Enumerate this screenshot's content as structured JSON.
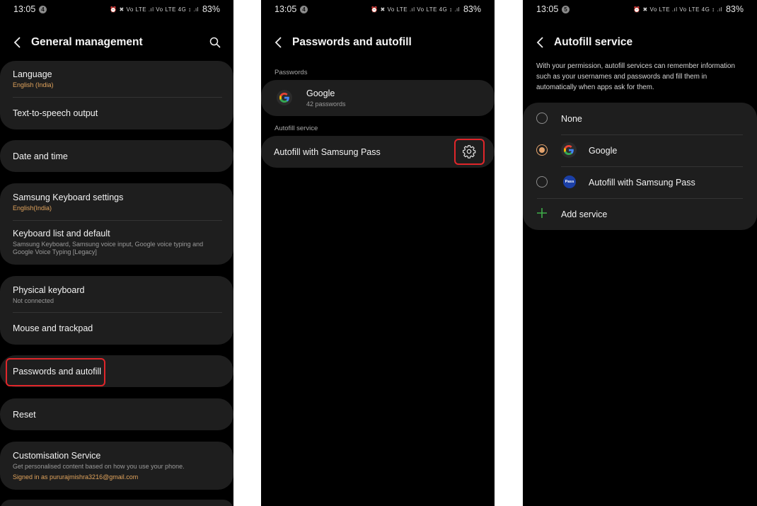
{
  "status": {
    "time": "13:05",
    "battery": "83%",
    "signal_text": "⏰ ✖ Vo LTE .ıl Vo LTE 4G ↕ .ıl"
  },
  "notifications": [
    "4",
    "4",
    "5"
  ],
  "screen1": {
    "title": "General management",
    "items": {
      "language": {
        "label": "Language",
        "sub": "English (India)"
      },
      "tts": {
        "label": "Text-to-speech output"
      },
      "date_time": {
        "label": "Date and time"
      },
      "keyboard_settings": {
        "label": "Samsung Keyboard settings",
        "sub": "English(India)"
      },
      "keyboard_list": {
        "label": "Keyboard list and default",
        "sub": "Samsung Keyboard, Samsung voice input, Google voice typing and Google Voice Typing [Legacy]"
      },
      "physical_keyboard": {
        "label": "Physical keyboard",
        "sub": "Not connected"
      },
      "mouse": {
        "label": "Mouse and trackpad"
      },
      "passwords": {
        "label": "Passwords and autofill"
      },
      "reset": {
        "label": "Reset"
      },
      "customisation": {
        "label": "Customisation Service",
        "sub": "Get personalised content based on how you use your phone.",
        "sub2": "Signed in as pururajmishra3216@gmail.com"
      }
    }
  },
  "screen2": {
    "title": "Passwords and autofill",
    "section_passwords": "Passwords",
    "google": {
      "name": "Google",
      "count": "42 passwords"
    },
    "section_autofill": "Autofill service",
    "autofill": {
      "label": "Autofill with Samsung Pass"
    }
  },
  "screen3": {
    "title": "Autofill service",
    "description": "With your permission, autofill services can remember information such as your usernames and passwords and fill them in automatically when apps ask for them.",
    "options": {
      "none": "None",
      "google": "Google",
      "samsung": "Autofill with Samsung Pass",
      "add": "Add service"
    },
    "pass_icon_text": "Pass",
    "selected": "Google"
  },
  "colors": {
    "highlight": "#e0262a",
    "accent": "#e3a36d",
    "add_green": "#3fae49",
    "samsung_blue": "#1b3fa6"
  }
}
